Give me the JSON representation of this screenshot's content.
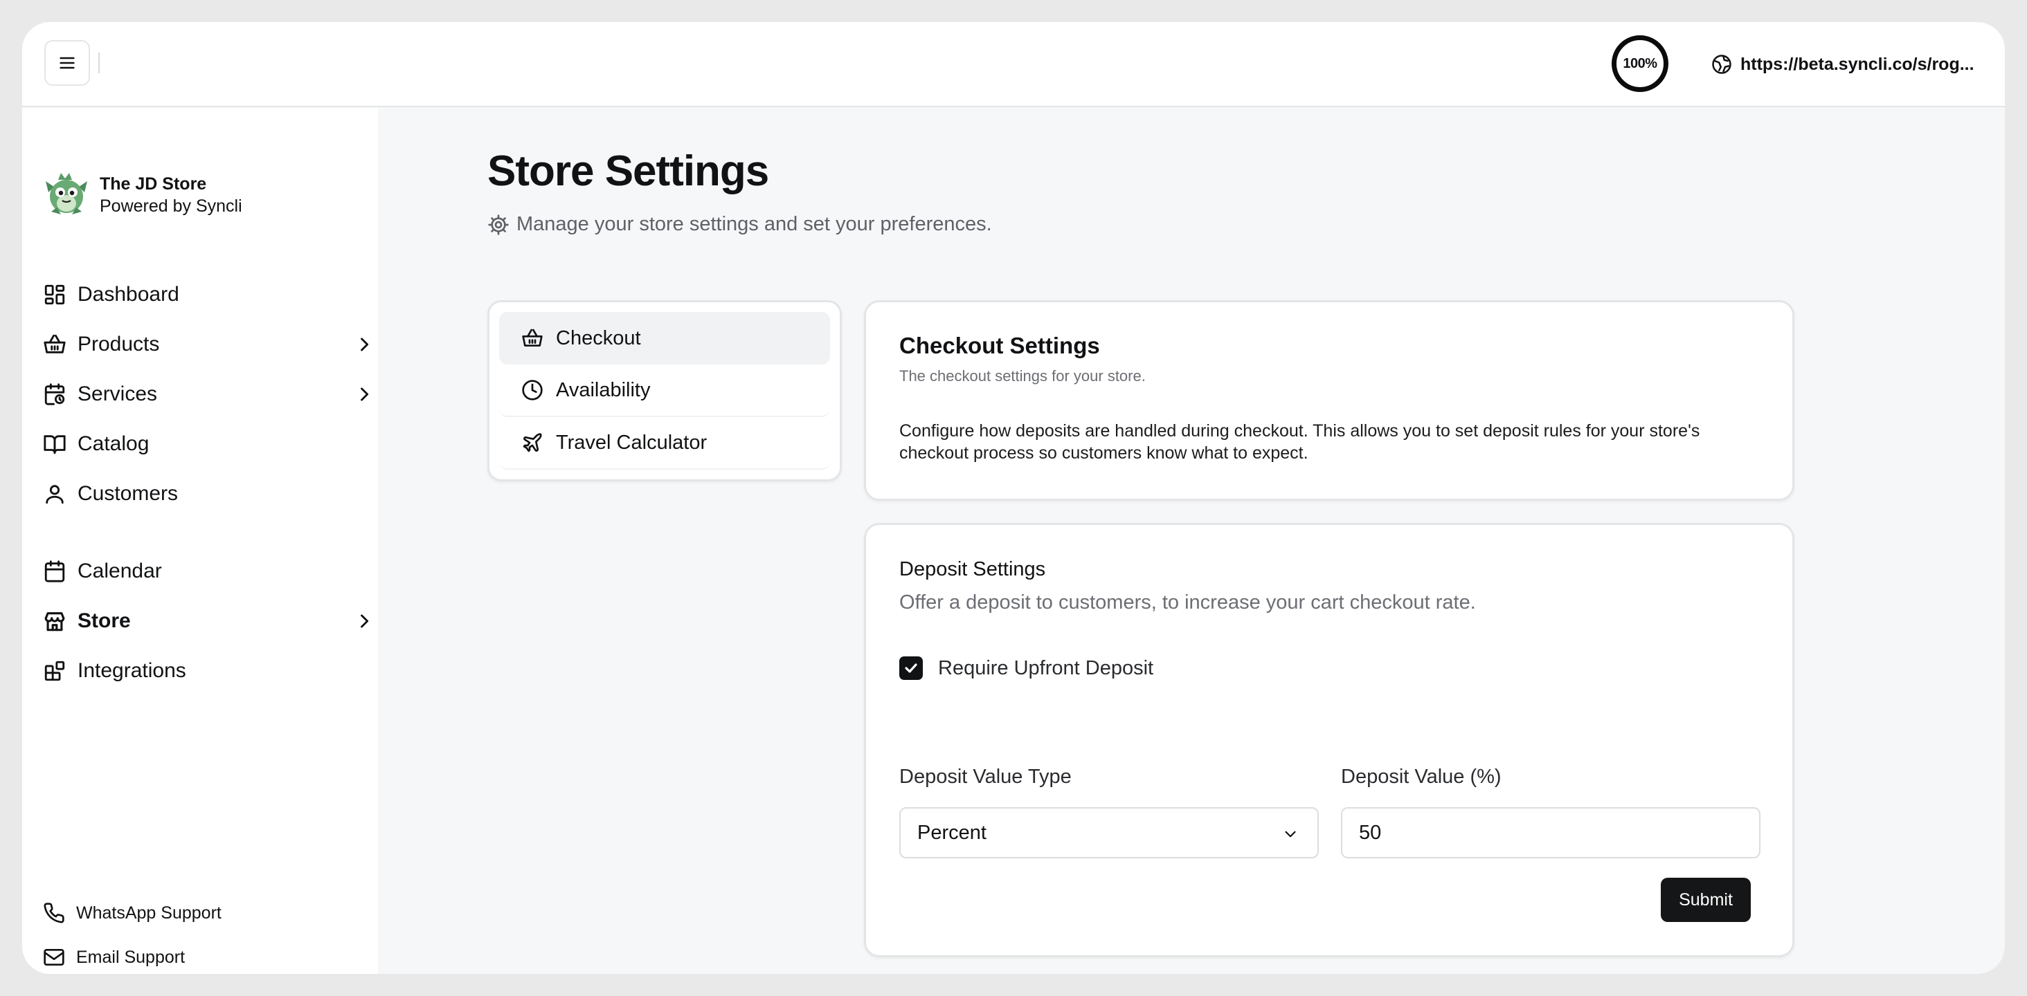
{
  "topbar": {
    "zoom": "100%",
    "url": "https://beta.syncli.co/s/rog..."
  },
  "brand": {
    "name": "The JD Store",
    "subtitle": "Powered by Syncli"
  },
  "sidebar": {
    "items": [
      {
        "label": "Dashboard",
        "icon": "dashboard-icon",
        "has_submenu": false
      },
      {
        "label": "Products",
        "icon": "basket-icon",
        "has_submenu": true
      },
      {
        "label": "Services",
        "icon": "calendar-clock-icon",
        "has_submenu": true
      },
      {
        "label": "Catalog",
        "icon": "book-open-icon",
        "has_submenu": false
      },
      {
        "label": "Customers",
        "icon": "user-icon",
        "has_submenu": false
      },
      {
        "label": "Calendar",
        "icon": "calendar-icon",
        "has_submenu": false
      },
      {
        "label": "Store",
        "icon": "store-icon",
        "has_submenu": true,
        "active": true
      },
      {
        "label": "Integrations",
        "icon": "blocks-icon",
        "has_submenu": false
      }
    ],
    "support": [
      {
        "label": "WhatsApp Support",
        "icon": "phone-icon"
      },
      {
        "label": "Email Support",
        "icon": "mail-icon"
      }
    ]
  },
  "page": {
    "title": "Store Settings",
    "subtitle": "Manage your store settings and set your preferences."
  },
  "settings_tabs": [
    {
      "label": "Checkout",
      "icon": "basket-icon",
      "active": true
    },
    {
      "label": "Availability",
      "icon": "clock-icon",
      "active": false
    },
    {
      "label": "Travel Calculator",
      "icon": "plane-icon",
      "active": false
    }
  ],
  "checkout_card": {
    "title": "Checkout Settings",
    "subtitle": "The checkout settings for your store.",
    "description": "Configure how deposits are handled during checkout. This allows you to set deposit rules for your store's checkout process so customers know what to expect."
  },
  "deposit_card": {
    "title": "Deposit Settings",
    "subtitle": "Offer a deposit to customers, to increase your cart checkout rate.",
    "require_label": "Require Upfront Deposit",
    "require_checked": true,
    "type_label": "Deposit Value Type",
    "type_value": "Percent",
    "value_label": "Deposit Value (%)",
    "value": "50",
    "submit_label": "Submit"
  },
  "colors": {
    "accent": "#151617",
    "background": "#f6f7f8",
    "border": "#e4e5e7"
  }
}
